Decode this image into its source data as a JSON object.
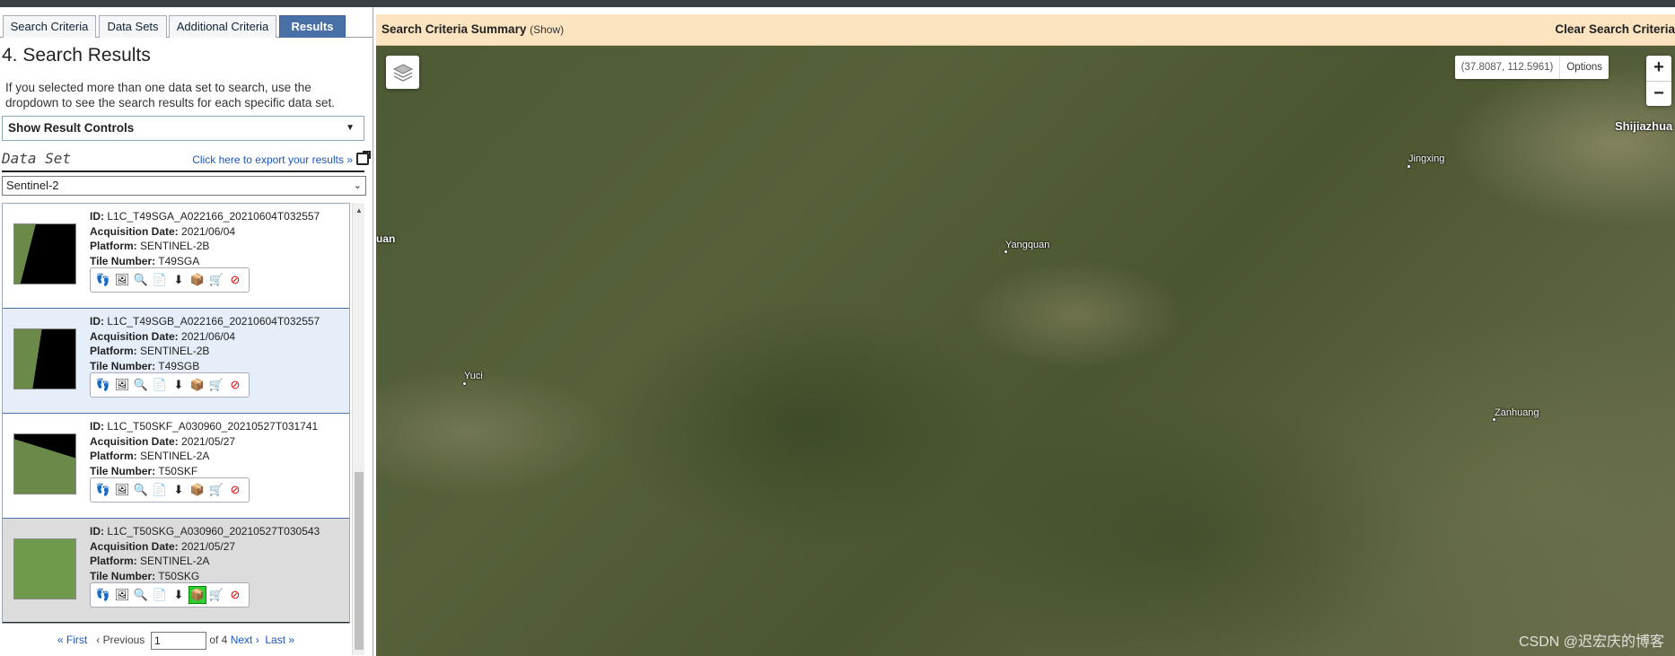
{
  "tabs": [
    {
      "label": "Search Criteria",
      "active": false
    },
    {
      "label": "Data Sets",
      "active": false
    },
    {
      "label": "Additional Criteria",
      "active": false
    },
    {
      "label": "Results",
      "active": true
    }
  ],
  "results_panel": {
    "title": "4. Search Results",
    "intro": "If you selected more than one data set to search, use the dropdown to see the search results for each specific data set.",
    "result_controls_label": "Show Result Controls",
    "dataset_label": "Data Set",
    "export_link": "Click here to export your results »",
    "dataset_selected": "Sentinel-2"
  },
  "items": [
    {
      "id": "L1C_T49SGA_A022166_20210604T032557",
      "acquisition_date": "2021/06/04",
      "platform": "SENTINEL-2B",
      "tile_number": "T49SGA"
    },
    {
      "id": "L1C_T49SGB_A022166_20210604T032557",
      "acquisition_date": "2021/06/04",
      "platform": "SENTINEL-2B",
      "tile_number": "T49SGB"
    },
    {
      "id": "L1C_T50SKF_A030960_20210527T031741",
      "acquisition_date": "2021/05/27",
      "platform": "SENTINEL-2A",
      "tile_number": "T50SKF"
    },
    {
      "id": "L1C_T50SKG_A030960_20210527T030543",
      "acquisition_date": "2021/05/27",
      "platform": "SENTINEL-2A",
      "tile_number": "T50SKG"
    }
  ],
  "field_labels": {
    "id": "ID:",
    "acquisition_date": "Acquisition Date:",
    "platform": "Platform:",
    "tile_number": "Tile Number:"
  },
  "pager": {
    "first": "« First",
    "previous": "‹ Previous",
    "page_value": "1",
    "of_text": "of 4",
    "next": "Next ›",
    "last": "Last »"
  },
  "summary": {
    "label": "Search Criteria Summary",
    "show": "(Show)",
    "clear": "Clear Search Criteria"
  },
  "map": {
    "coordinates": "(37.8087, 112.5961)",
    "options_label": "Options",
    "zoom_in": "+",
    "zoom_out": "−",
    "places": {
      "shijiazhuang": "Shijiazhua",
      "jingxing": "Jingxing",
      "yangquan": "Yangquan",
      "yuci": "Yuci",
      "zanhuang": "Zanhuang",
      "edge": "uan"
    },
    "watermark": "CSDN @迟宏庆的博客"
  },
  "colors": {
    "active_tab": "#4a70a8",
    "summary_bg": "#fce4c0",
    "link": "#1a56c4"
  }
}
